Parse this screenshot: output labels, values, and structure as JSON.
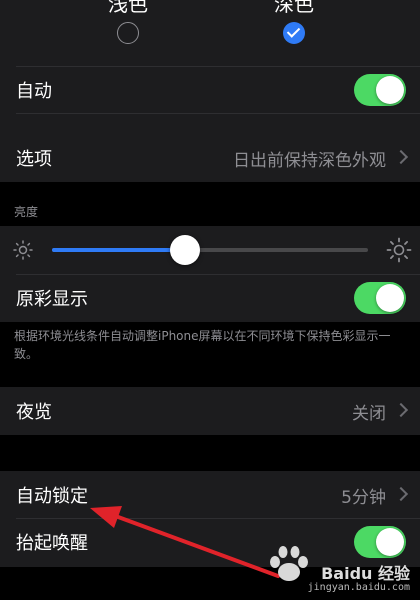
{
  "appearance": {
    "light_label": "浅色",
    "dark_label": "深色",
    "selected": "dark"
  },
  "auto_row": {
    "label": "自动",
    "toggle_on": true
  },
  "options_row": {
    "label": "选项",
    "value": "日出前保持深色外观"
  },
  "brightness": {
    "caption": "亮度",
    "level": 0.42
  },
  "true_tone": {
    "label": "原彩显示",
    "toggle_on": true,
    "footnote": "根据环境光线条件自动调整iPhone屏幕以在不同环境下保持色彩显示一致。"
  },
  "night_shift": {
    "label": "夜览",
    "value": "关闭"
  },
  "auto_lock": {
    "label": "自动锁定",
    "value": "5分钟"
  },
  "raise_to_wake": {
    "label": "抬起唤醒",
    "toggle_on": true
  },
  "watermark": {
    "brand": "Baidu 经验",
    "url": "jingyan.baidu.com"
  },
  "colors": {
    "background": "#000000",
    "cell": "#1c1c1e",
    "toggle_on": "#4cd964",
    "accent": "#2f7bf6",
    "secondary_text": "#8e8e93",
    "arrow": "#e0232a"
  }
}
